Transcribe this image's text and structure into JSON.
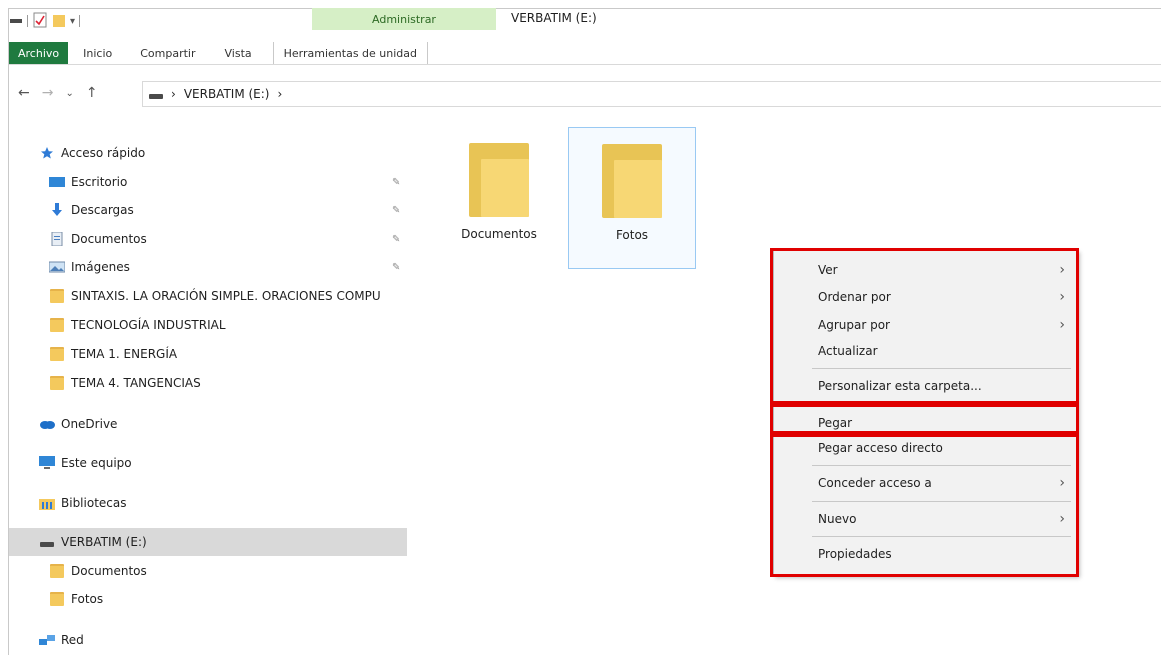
{
  "title_bar": {
    "context_group": "Administrar",
    "window_title": "VERBATIM (E:)"
  },
  "ribbon": {
    "tabs": [
      "Archivo",
      "Inicio",
      "Compartir",
      "Vista"
    ],
    "context_tab": "Herramientas de unidad"
  },
  "address_bar": {
    "path_item": "VERBATIM (E:)",
    "separator": "›"
  },
  "nav_pane": {
    "quick_access": "Acceso rápido",
    "items": [
      {
        "label": "Escritorio",
        "icon": "desktop-icon",
        "pinned": true
      },
      {
        "label": "Descargas",
        "icon": "download-icon",
        "pinned": true
      },
      {
        "label": "Documentos",
        "icon": "document-icon",
        "pinned": true
      },
      {
        "label": "Imágenes",
        "icon": "image-icon",
        "pinned": true
      },
      {
        "label": "SINTAXIS. LA ORACIÓN SIMPLE. ORACIONES COMPU",
        "icon": "folder-icon"
      },
      {
        "label": "TECNOLOGÍA INDUSTRIAL",
        "icon": "folder-icon"
      },
      {
        "label": "TEMA 1. ENERGÍA",
        "icon": "folder-icon"
      },
      {
        "label": "TEMA 4. TANGENCIAS",
        "icon": "folder-icon"
      }
    ],
    "onedrive": "OneDrive",
    "this_pc": "Este equipo",
    "libraries": "Bibliotecas",
    "drive": "VERBATIM (E:)",
    "drive_children": [
      "Documentos",
      "Fotos"
    ],
    "network": "Red"
  },
  "content": {
    "folders": [
      {
        "label": "Documentos",
        "selected": false
      },
      {
        "label": "Fotos",
        "selected": true
      }
    ]
  },
  "context_menu": {
    "items": [
      {
        "label": "Ver",
        "submenu": true
      },
      {
        "label": "Ordenar por",
        "submenu": true
      },
      {
        "label": "Agrupar por",
        "submenu": true
      },
      {
        "label": "Actualizar",
        "submenu": false
      },
      {
        "label": "Personalizar esta carpeta...",
        "submenu": false
      },
      {
        "label": "Pegar",
        "submenu": false,
        "highlighted": true
      },
      {
        "label": "Pegar acceso directo",
        "submenu": false
      },
      {
        "label": "Conceder acceso a",
        "submenu": true
      },
      {
        "label": "Nuevo",
        "submenu": true
      },
      {
        "label": "Propiedades",
        "submenu": false
      }
    ]
  },
  "colors": {
    "file_tab": "#1f7a3f",
    "context_group": "#d6efc6",
    "highlight": "#e00000",
    "selection": "#d9d9d9"
  }
}
